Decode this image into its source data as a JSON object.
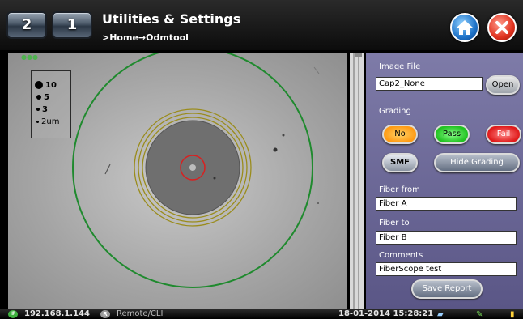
{
  "header": {
    "tab_2_label": "2",
    "tab_1_label": "1",
    "title": "Utilities & Settings",
    "breadcrumb": ">Home→Odmtool"
  },
  "viewer": {
    "scale": [
      {
        "label": "10"
      },
      {
        "label": "5"
      },
      {
        "label": "3"
      },
      {
        "label": "2um"
      }
    ],
    "colors": {
      "outer_ring": "#1f8a2e",
      "inner_rings": "#9a8c1c",
      "core_ring": "#d92020"
    }
  },
  "panel": {
    "image_file_label": "Image File",
    "image_file_value": "Cap2_None",
    "open_label": "Open",
    "grading_label": "Grading",
    "no_label": "No",
    "pass_label": "Pass",
    "fail_label": "Fail",
    "smf_label": "SMF",
    "hide_grading_label": "Hide Grading",
    "fiber_from_label": "Fiber from",
    "fiber_from_value": "Fiber A",
    "fiber_to_label": "Fiber to",
    "fiber_to_value": "Fiber B",
    "comments_label": "Comments",
    "comments_value": "FiberScope test",
    "save_report_label": "Save Report"
  },
  "statusbar": {
    "ip_badge": "IP",
    "ip": "192.168.1.144",
    "remote_badge": "R",
    "remote": "Remote/CLI",
    "datetime": "18-01-2014  15:28:21",
    "icons": [
      "signal-icon",
      "plug-icon",
      "battery-icon"
    ]
  }
}
